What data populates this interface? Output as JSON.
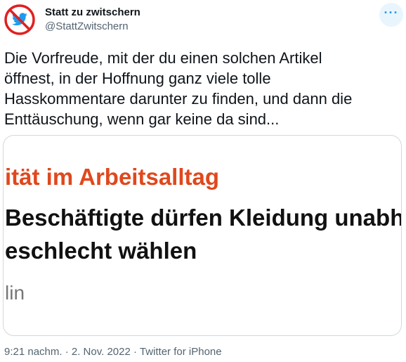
{
  "author": {
    "name": "Statt zu zwitschern",
    "handle": "@StattZwitschern"
  },
  "tweet": {
    "text": "Die Vorfreude, mit der du einen solchen Artikel\nöffnest, in der Hoffnung ganz viele tolle\nHasskommentare darunter zu finden, und dann die\nEnttäuschung, wenn gar keine da sind..."
  },
  "card": {
    "kicker": "ität im Arbeitsalltag",
    "headline_line1": "Beschäftigte dürfen Kleidung unabh",
    "headline_line2": "eschlecht wählen",
    "byline": "lin"
  },
  "meta": {
    "timestamp": "9:21 nachm. · 2. Nov. 2022 · Twitter for iPhone"
  },
  "colors": {
    "accent": "#1d9bf0",
    "kicker": "#e0481d",
    "no_sign": "#e02020"
  },
  "icons": {
    "avatar": "bird-no-sign-icon",
    "more": "more-options-icon"
  }
}
